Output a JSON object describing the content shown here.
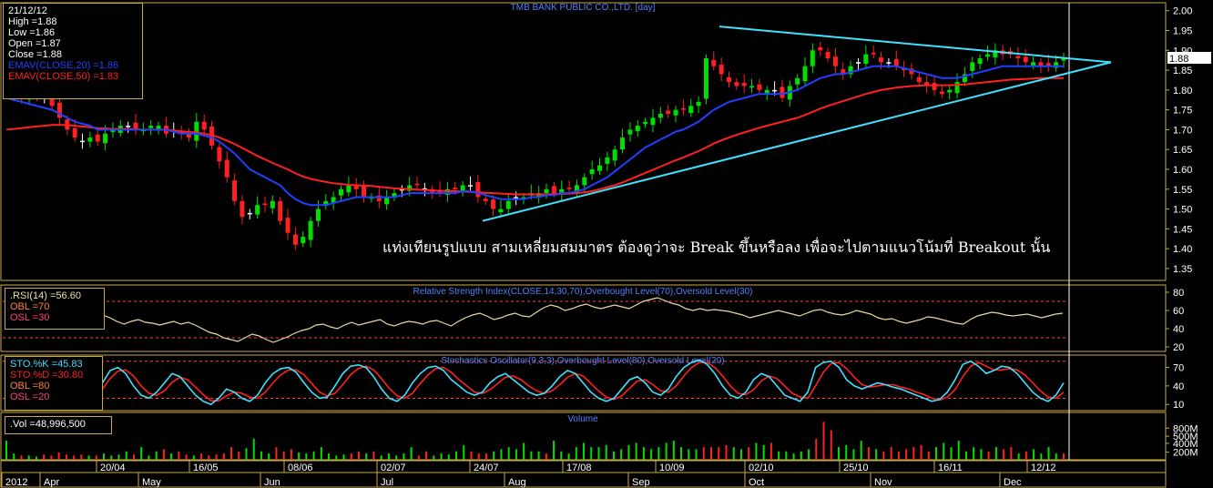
{
  "chart_data": {
    "type": "candlestick",
    "title": "TMB BANK PUBLIC CO.,LTD. [day]",
    "last_price_label": "1.88",
    "price_axis": {
      "ticks": [
        "2.00",
        "1.95",
        "1.90",
        "1.85",
        "1.80",
        "1.75",
        "1.70",
        "1.65",
        "1.60",
        "1.55",
        "1.50",
        "1.45",
        "1.40",
        "1.35"
      ],
      "ylim": [
        1.32,
        2.02
      ]
    },
    "date_labels": [
      "2012",
      "Apr",
      "20/04",
      "May",
      "16/05",
      "Jun",
      "08/06",
      "02/07",
      "Jul",
      "24/07",
      "Aug",
      "17/08",
      "Sep",
      "10/09",
      "02/10",
      "Oct",
      "25/10",
      "Nov",
      "16/11",
      "Dec",
      "12/12"
    ],
    "annotation": "แท่งเทียนรูปแบบ สามเหลี่ยมสมมาตร ต้องดูว่าจะ Break ขึ้นหรือลง เพื่อจะไปตามแนวโน้มที่ Breakout นั้น",
    "info": {
      "date": "21/12/12",
      "high": "High =1.88",
      "low": "Low =1.86",
      "open": "Open =1.87",
      "close": "Close =1.88",
      "ema20": "EMAV(CLOSE,20) =1.86",
      "ema50": "EMAV(CLOSE,50) =1.83"
    },
    "price_series": [
      1.79,
      1.79,
      1.78,
      1.79,
      1.79,
      1.78,
      1.76,
      1.73,
      1.7,
      1.68,
      1.67,
      1.68,
      1.67,
      1.69,
      1.7,
      1.71,
      1.71,
      1.7,
      1.7,
      1.71,
      1.71,
      1.69,
      1.7,
      1.69,
      1.68,
      1.72,
      1.7,
      1.66,
      1.62,
      1.58,
      1.52,
      1.48,
      1.49,
      1.51,
      1.51,
      1.52,
      1.47,
      1.44,
      1.41,
      1.43,
      1.47,
      1.5,
      1.52,
      1.53,
      1.55,
      1.56,
      1.55,
      1.53,
      1.53,
      1.52,
      1.53,
      1.54,
      1.55,
      1.56,
      1.56,
      1.55,
      1.54,
      1.54,
      1.55,
      1.55,
      1.56,
      1.56,
      1.53,
      1.52,
      1.5,
      1.5,
      1.52,
      1.53,
      1.53,
      1.54,
      1.54,
      1.55,
      1.54,
      1.55,
      1.55,
      1.56,
      1.58,
      1.6,
      1.61,
      1.63,
      1.65,
      1.68,
      1.7,
      1.71,
      1.72,
      1.73,
      1.74,
      1.74,
      1.75,
      1.75,
      1.76,
      1.77,
      1.88,
      1.86,
      1.84,
      1.82,
      1.81,
      1.81,
      1.81,
      1.8,
      1.8,
      1.8,
      1.78,
      1.81,
      1.83,
      1.86,
      1.9,
      1.9,
      1.88,
      1.86,
      1.84,
      1.86,
      1.87,
      1.89,
      1.89,
      1.87,
      1.87,
      1.86,
      1.85,
      1.84,
      1.82,
      1.81,
      1.8,
      1.79,
      1.8,
      1.82,
      1.84,
      1.87,
      1.88,
      1.89,
      1.9,
      1.89,
      1.89,
      1.88,
      1.87,
      1.87,
      1.86,
      1.86,
      1.87,
      1.88
    ],
    "ema20": [
      1.78,
      1.775,
      1.77,
      1.765,
      1.76,
      1.755,
      1.75,
      1.74,
      1.73,
      1.72,
      1.715,
      1.71,
      1.7,
      1.7,
      1.7,
      1.7,
      1.7,
      1.7,
      1.7,
      1.7,
      1.7,
      1.7,
      1.695,
      1.69,
      1.69,
      1.69,
      1.685,
      1.68,
      1.67,
      1.655,
      1.64,
      1.62,
      1.6,
      1.59,
      1.58,
      1.57,
      1.56,
      1.54,
      1.525,
      1.515,
      1.51,
      1.51,
      1.51,
      1.515,
      1.52,
      1.525,
      1.53,
      1.53,
      1.53,
      1.53,
      1.53,
      1.53,
      1.535,
      1.54,
      1.54,
      1.54,
      1.54,
      1.54,
      1.54,
      1.54,
      1.545,
      1.545,
      1.54,
      1.535,
      1.53,
      1.525,
      1.525,
      1.525,
      1.525,
      1.53,
      1.53,
      1.535,
      1.535,
      1.54,
      1.54,
      1.545,
      1.55,
      1.56,
      1.57,
      1.58,
      1.595,
      1.61,
      1.625,
      1.64,
      1.655,
      1.665,
      1.675,
      1.685,
      1.695,
      1.7,
      1.71,
      1.72,
      1.735,
      1.75,
      1.76,
      1.77,
      1.775,
      1.78,
      1.785,
      1.79,
      1.79,
      1.79,
      1.79,
      1.795,
      1.8,
      1.81,
      1.82,
      1.83,
      1.835,
      1.84,
      1.84,
      1.845,
      1.85,
      1.855,
      1.86,
      1.86,
      1.86,
      1.86,
      1.855,
      1.85,
      1.845,
      1.84,
      1.835,
      1.83,
      1.83,
      1.83,
      1.835,
      1.84,
      1.845,
      1.85,
      1.855,
      1.86,
      1.86,
      1.86,
      1.86,
      1.86,
      1.86,
      1.86,
      1.86,
      1.86
    ],
    "ema50": [
      1.7,
      1.702,
      1.704,
      1.706,
      1.708,
      1.71,
      1.712,
      1.712,
      1.712,
      1.71,
      1.708,
      1.706,
      1.704,
      1.703,
      1.702,
      1.702,
      1.702,
      1.701,
      1.7,
      1.7,
      1.7,
      1.7,
      1.698,
      1.696,
      1.694,
      1.693,
      1.69,
      1.686,
      1.68,
      1.672,
      1.664,
      1.654,
      1.644,
      1.634,
      1.625,
      1.616,
      1.608,
      1.6,
      1.59,
      1.582,
      1.576,
      1.572,
      1.568,
      1.565,
      1.563,
      1.561,
      1.56,
      1.559,
      1.558,
      1.556,
      1.554,
      1.552,
      1.551,
      1.55,
      1.549,
      1.548,
      1.547,
      1.546,
      1.545,
      1.545,
      1.544,
      1.543,
      1.542,
      1.541,
      1.54,
      1.539,
      1.538,
      1.537,
      1.537,
      1.537,
      1.537,
      1.537,
      1.538,
      1.538,
      1.539,
      1.54,
      1.542,
      1.545,
      1.55,
      1.555,
      1.56,
      1.567,
      1.575,
      1.583,
      1.591,
      1.599,
      1.607,
      1.615,
      1.623,
      1.63,
      1.638,
      1.646,
      1.655,
      1.665,
      1.673,
      1.68,
      1.687,
      1.693,
      1.699,
      1.705,
      1.71,
      1.715,
      1.72,
      1.725,
      1.73,
      1.737,
      1.745,
      1.753,
      1.76,
      1.766,
      1.772,
      1.778,
      1.784,
      1.79,
      1.795,
      1.8,
      1.803,
      1.806,
      1.808,
      1.81,
      1.811,
      1.812,
      1.812,
      1.812,
      1.812,
      1.813,
      1.814,
      1.816,
      1.818,
      1.82,
      1.822,
      1.824,
      1.826,
      1.827,
      1.828,
      1.829,
      1.83,
      1.83,
      1.83,
      1.83
    ],
    "trendlines": [
      {
        "from": [
          1.47,
          "24/07"
        ],
        "to": [
          1.87,
          "apex"
        ]
      },
      {
        "from": [
          1.96,
          "Sep"
        ],
        "to": [
          1.87,
          "apex"
        ]
      }
    ],
    "rsi": {
      "title": "Relative Strength Index(CLOSE,14,30,70),Overbought Level(70),Oversold Level(30)",
      "ticks": [
        "80",
        "60",
        "40",
        "20"
      ],
      "ylim": [
        15,
        88
      ],
      "labels": [
        ".RSI(14)  =56.60",
        "OBL  =70",
        "OSL  =30"
      ],
      "values": [
        58,
        55,
        52,
        48,
        45,
        48,
        50,
        47,
        46,
        44,
        46,
        48,
        45,
        47,
        44,
        40,
        36,
        34,
        30,
        28,
        26,
        30,
        34,
        32,
        28,
        25,
        28,
        31,
        35,
        38,
        40,
        44,
        45,
        42,
        40,
        44,
        47,
        44,
        46,
        48,
        50,
        45,
        43,
        46,
        48,
        47,
        45,
        48,
        49,
        46,
        43,
        48,
        52,
        55,
        57,
        54,
        50,
        52,
        55,
        57,
        54,
        53,
        58,
        63,
        66,
        64,
        60,
        62,
        65,
        67,
        64,
        62,
        64,
        66,
        64,
        62,
        66,
        70,
        72,
        74,
        71,
        68,
        66,
        62,
        60,
        62,
        60,
        61,
        60,
        59,
        57,
        55,
        52,
        54,
        56,
        58,
        60,
        58,
        56,
        54,
        57,
        60,
        61,
        58,
        56,
        55,
        57,
        60,
        58,
        56,
        52,
        50,
        51,
        48,
        46,
        48,
        50,
        53,
        52,
        50,
        48,
        46,
        45,
        50,
        54,
        56,
        58,
        57,
        55,
        54,
        55,
        56,
        54,
        52,
        54,
        56,
        57
      ]
    },
    "stochastics": {
      "title": "Stochastics Oscillator(9,3,3),Overbought Level(80),Oversold Level(20)",
      "ticks": [
        "70",
        "40",
        "10"
      ],
      "ylim": [
        0,
        90
      ],
      "labels": [
        "STO.%K  =45.83",
        "STO.%D  =30.80",
        "OBL  =80",
        "OSL  =20"
      ],
      "k": [
        30,
        45,
        65,
        70,
        60,
        40,
        25,
        20,
        30,
        45,
        60,
        55,
        40,
        25,
        15,
        10,
        20,
        35,
        30,
        20,
        15,
        25,
        45,
        60,
        68,
        70,
        62,
        45,
        30,
        20,
        22,
        40,
        60,
        72,
        74,
        70,
        55,
        35,
        20,
        15,
        25,
        45,
        60,
        70,
        72,
        65,
        50,
        40,
        30,
        25,
        30,
        45,
        55,
        60,
        50,
        40,
        30,
        25,
        28,
        40,
        55,
        65,
        60,
        45,
        30,
        20,
        15,
        20,
        35,
        50,
        55,
        45,
        30,
        25,
        35,
        55,
        70,
        78,
        82,
        75,
        60,
        40,
        25,
        20,
        30,
        50,
        60,
        55,
        40,
        25,
        20,
        15,
        30,
        70,
        78,
        80,
        70,
        50,
        40,
        35,
        40,
        45,
        42,
        38,
        35,
        30,
        25,
        20,
        15,
        18,
        30,
        50,
        75,
        80,
        72,
        60,
        65,
        72,
        70,
        60,
        45,
        30,
        20,
        15,
        25,
        45
      ],
      "d": [
        25,
        35,
        52,
        64,
        66,
        56,
        40,
        28,
        25,
        32,
        46,
        54,
        50,
        38,
        26,
        16,
        16,
        24,
        30,
        28,
        22,
        20,
        30,
        45,
        58,
        66,
        66,
        58,
        44,
        30,
        24,
        28,
        42,
        58,
        68,
        72,
        66,
        52,
        36,
        24,
        20,
        28,
        44,
        58,
        68,
        70,
        62,
        50,
        40,
        30,
        28,
        34,
        44,
        54,
        56,
        50,
        40,
        32,
        28,
        32,
        42,
        54,
        60,
        56,
        44,
        32,
        22,
        18,
        24,
        36,
        48,
        50,
        42,
        32,
        30,
        40,
        56,
        70,
        78,
        78,
        70,
        56,
        40,
        28,
        26,
        34,
        48,
        56,
        52,
        40,
        28,
        22,
        20,
        40,
        62,
        76,
        78,
        68,
        54,
        42,
        38,
        40,
        42,
        42,
        38,
        35,
        30,
        26,
        20,
        17,
        22,
        34,
        55,
        72,
        78,
        72,
        66,
        66,
        68,
        66,
        58,
        45,
        32,
        22,
        20,
        30
      ]
    },
    "volume": {
      "title": "Volume",
      "ticks": [
        "800M",
        "500M",
        "400M",
        "200M"
      ],
      "label": ".Vol  =48,996,500",
      "values": [
        90,
        30,
        20,
        20,
        15,
        25,
        20,
        35,
        25,
        20,
        25,
        20,
        20,
        30,
        20,
        25,
        40,
        25,
        60,
        20,
        40,
        50,
        30,
        40,
        25,
        20,
        30,
        20,
        25,
        30,
        60,
        40,
        55,
        100,
        40,
        30,
        60,
        40,
        50,
        35,
        30,
        40,
        60,
        30,
        20,
        25,
        30,
        40,
        30,
        40,
        20,
        30,
        20,
        30,
        60,
        20,
        40,
        20,
        30,
        25,
        40,
        70,
        40,
        30,
        30,
        40,
        50,
        60,
        50,
        80,
        40,
        40,
        30,
        90,
        40,
        30,
        60,
        80,
        60,
        60,
        70,
        40,
        50,
        70,
        80,
        60,
        50,
        60,
        80,
        90,
        60,
        50,
        50,
        60,
        60,
        60,
        70,
        60,
        50,
        60,
        80,
        70,
        80,
        40,
        40,
        30,
        40,
        50,
        100,
        180,
        140,
        60,
        70,
        50,
        90,
        60,
        50,
        40,
        60,
        40,
        50,
        60,
        70,
        40,
        60,
        80,
        60,
        90,
        40,
        60,
        50,
        40,
        60,
        50,
        60,
        30,
        40,
        50,
        30,
        60,
        30,
        30
      ],
      "ylim": [
        0,
        190
      ]
    }
  }
}
